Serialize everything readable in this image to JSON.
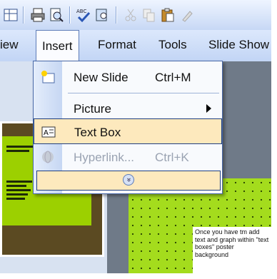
{
  "menubar": {
    "view_partial": "iew",
    "insert": "Insert",
    "format": "Format",
    "tools": "Tools",
    "slideshow_partial": "Slide Show"
  },
  "insert_menu": {
    "items": [
      {
        "label": "New Slide",
        "shortcut": "Ctrl+M",
        "icon": "new-slide-icon",
        "state": "enabled"
      },
      {
        "label": "Picture",
        "shortcut": "",
        "icon": "",
        "state": "enabled",
        "submenu": true
      },
      {
        "label": "Text Box",
        "shortcut": "",
        "icon": "text-box-icon",
        "state": "highlighted"
      },
      {
        "label": "Hyperlink...",
        "shortcut": "Ctrl+K",
        "icon": "hyperlink-icon",
        "state": "disabled"
      }
    ],
    "expand_icon": "double-chevron-down-icon"
  },
  "slide": {
    "text": "Once you have tm add text and graph within \"text boxes\" poster background"
  },
  "colors": {
    "highlight": "#fde9bd",
    "slide_green": "#a4dc1d",
    "menu_border": "#1f3f80"
  }
}
